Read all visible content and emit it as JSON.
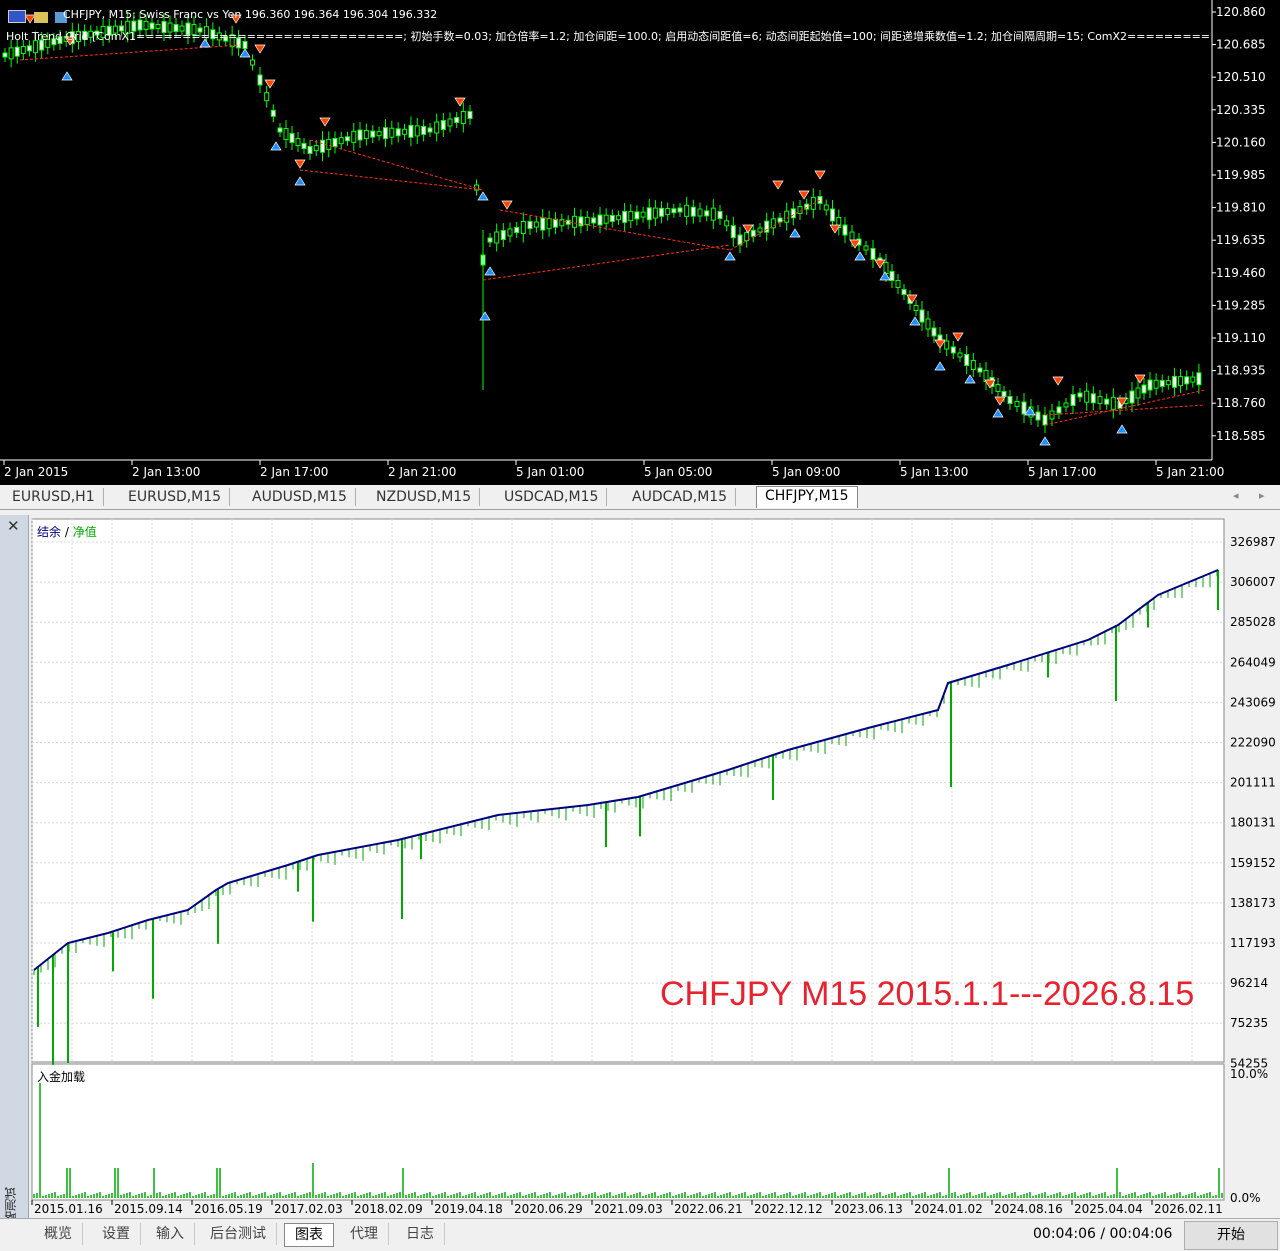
{
  "chart": {
    "icon_names": [
      "flag-icon",
      "expert-icon",
      "smile-icon"
    ],
    "header_line": "CHFJPY, M15:  Swiss Franc vs Yen  196.360 196.364 196.304 196.332",
    "expert_line": "Holt Trend Grid [ComX1=============================; 初始手数=0.03; 加仓倍率=1.2; 加仓间距=100.0; 启用动态间距值=6; 动态间距起始值=100; 间距递增乘数值=1.2; 加仓间隔周期=15; ComX2=============================",
    "price_labels": [
      "120.860",
      "120.685",
      "120.510",
      "120.335",
      "120.160",
      "119.985",
      "119.810",
      "119.635",
      "119.460",
      "119.285",
      "119.110",
      "118.935",
      "118.760",
      "118.585"
    ],
    "time_labels": [
      "2 Jan 2015",
      "2 Jan 13:00",
      "2 Jan 17:00",
      "2 Jan 21:00",
      "5 Jan 01:00",
      "5 Jan 05:00",
      "5 Jan 09:00",
      "5 Jan 13:00",
      "5 Jan 17:00",
      "5 Jan 21:00"
    ],
    "colors": {
      "background": "#000000",
      "bull": "#00ff00",
      "buy_arrow": "#1e90ff",
      "sell_arrow": "#ff4500",
      "trade_line": "#ff3300"
    }
  },
  "symbol_tabs": [
    "EURUSD,H1",
    "EURUSD,M15",
    "AUDUSD,M15",
    "NZDUSD,M15",
    "USDCAD,M15",
    "AUDCAD,M15",
    "CHFJPY,M15"
  ],
  "symbol_tab_active": "CHFJPY,M15",
  "tester": {
    "legend_balance": "结余",
    "legend_sep": " / ",
    "legend_equity": "净值",
    "overlay_text": "CHFJPY M15 2015.1.1---2026.8.15",
    "y_labels": [
      "326987",
      "306007",
      "285028",
      "264049",
      "243069",
      "222090",
      "201111",
      "180131",
      "159152",
      "138173",
      "117193",
      "96214",
      "75235",
      "54255"
    ],
    "deposit_label": "入金加载",
    "deposit_axis": [
      "10.0%",
      "0.0%"
    ],
    "x_labels": [
      "2015.01.16",
      "2015.09.14",
      "2016.05.19",
      "2017.02.03",
      "2018.02.09",
      "2019.04.18",
      "2020.06.29",
      "2021.09.03",
      "2022.06.21",
      "2022.12.12",
      "2023.06.13",
      "2024.01.02",
      "2024.08.16",
      "2025.04.04",
      "2026.02.11"
    ],
    "side_label": "策略测试",
    "colors": {
      "balance": "#000080",
      "equity": "#00aa00",
      "overlay": "#e8222e"
    }
  },
  "bottom_tabs": [
    "概览",
    "设置",
    "输入",
    "后台测试",
    "图表",
    "代理",
    "日志"
  ],
  "bottom_tab_active": "图表",
  "timer": "00:04:06 / 00:04:06",
  "start_button": "开始"
}
